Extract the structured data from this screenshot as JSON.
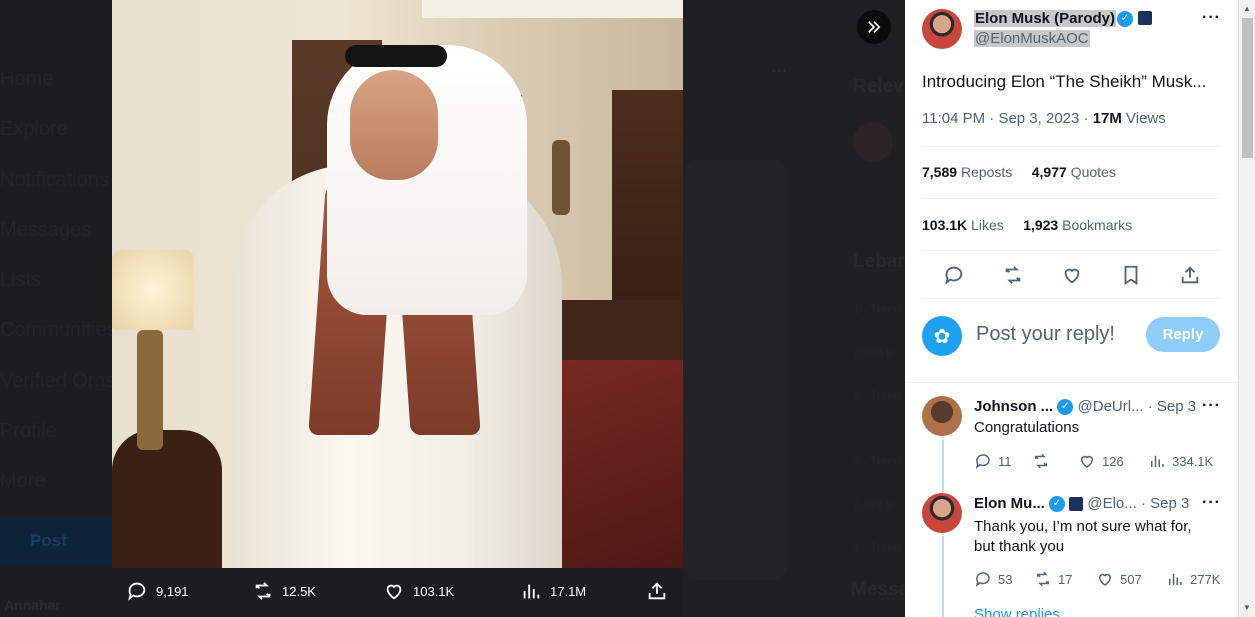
{
  "background_nav": {
    "items": [
      "Home",
      "Explore",
      "Notifications",
      "Messages",
      "Lists",
      "Communities",
      "Verified Orgs",
      "Profile",
      "More"
    ],
    "post_label": "Post",
    "user_name": "Annahar"
  },
  "background_right": {
    "relevant_heading": "Relev",
    "trends_heading": "Lebar",
    "trend_lines": [
      "1 · Trend",
      "2,993 p",
      "2 · Trend",
      "3 · Trend",
      "2,892 p",
      "4 · Trend"
    ],
    "messages_heading": "Messa"
  },
  "photo_actions": {
    "replies": "9,191",
    "reposts": "12.5K",
    "likes": "103.1K",
    "views": "17.1M"
  },
  "tweet": {
    "author_name": "Elon Musk (Parody)",
    "author_handle": "@ElonMuskAOC",
    "text": "Introducing Elon “The Sheikh” Musk...",
    "time": "11:04 PM",
    "date": "Sep 3, 2023",
    "views_count": "17M",
    "views_label": "Views",
    "reposts_count": "7,589",
    "reposts_label": "Reposts",
    "quotes_count": "4,977",
    "quotes_label": "Quotes",
    "likes_count": "103.1K",
    "likes_label": "Likes",
    "bookmarks_count": "1,923",
    "bookmarks_label": "Bookmarks"
  },
  "reply_box": {
    "placeholder": "Post your reply!",
    "button_label": "Reply"
  },
  "comments": [
    {
      "name": "Johnson ...",
      "handle": "@DeUrl...",
      "date": "· Sep 3",
      "text": "Congratulations",
      "replies": "11",
      "reposts": "",
      "likes": "126",
      "views": "334.1K"
    },
    {
      "name": "Elon Mu...",
      "handle": "@Elo...",
      "date": "· Sep 3",
      "text": "Thank you, I’m not sure what for, but thank you",
      "replies": "53",
      "reposts": "17",
      "likes": "507",
      "views": "277K"
    }
  ],
  "show_replies": "Show replies",
  "colors": {
    "accent": "#1d9bf0",
    "reply_button": "#8ecdf7",
    "text_primary": "#0f1419",
    "text_secondary": "#536471"
  }
}
